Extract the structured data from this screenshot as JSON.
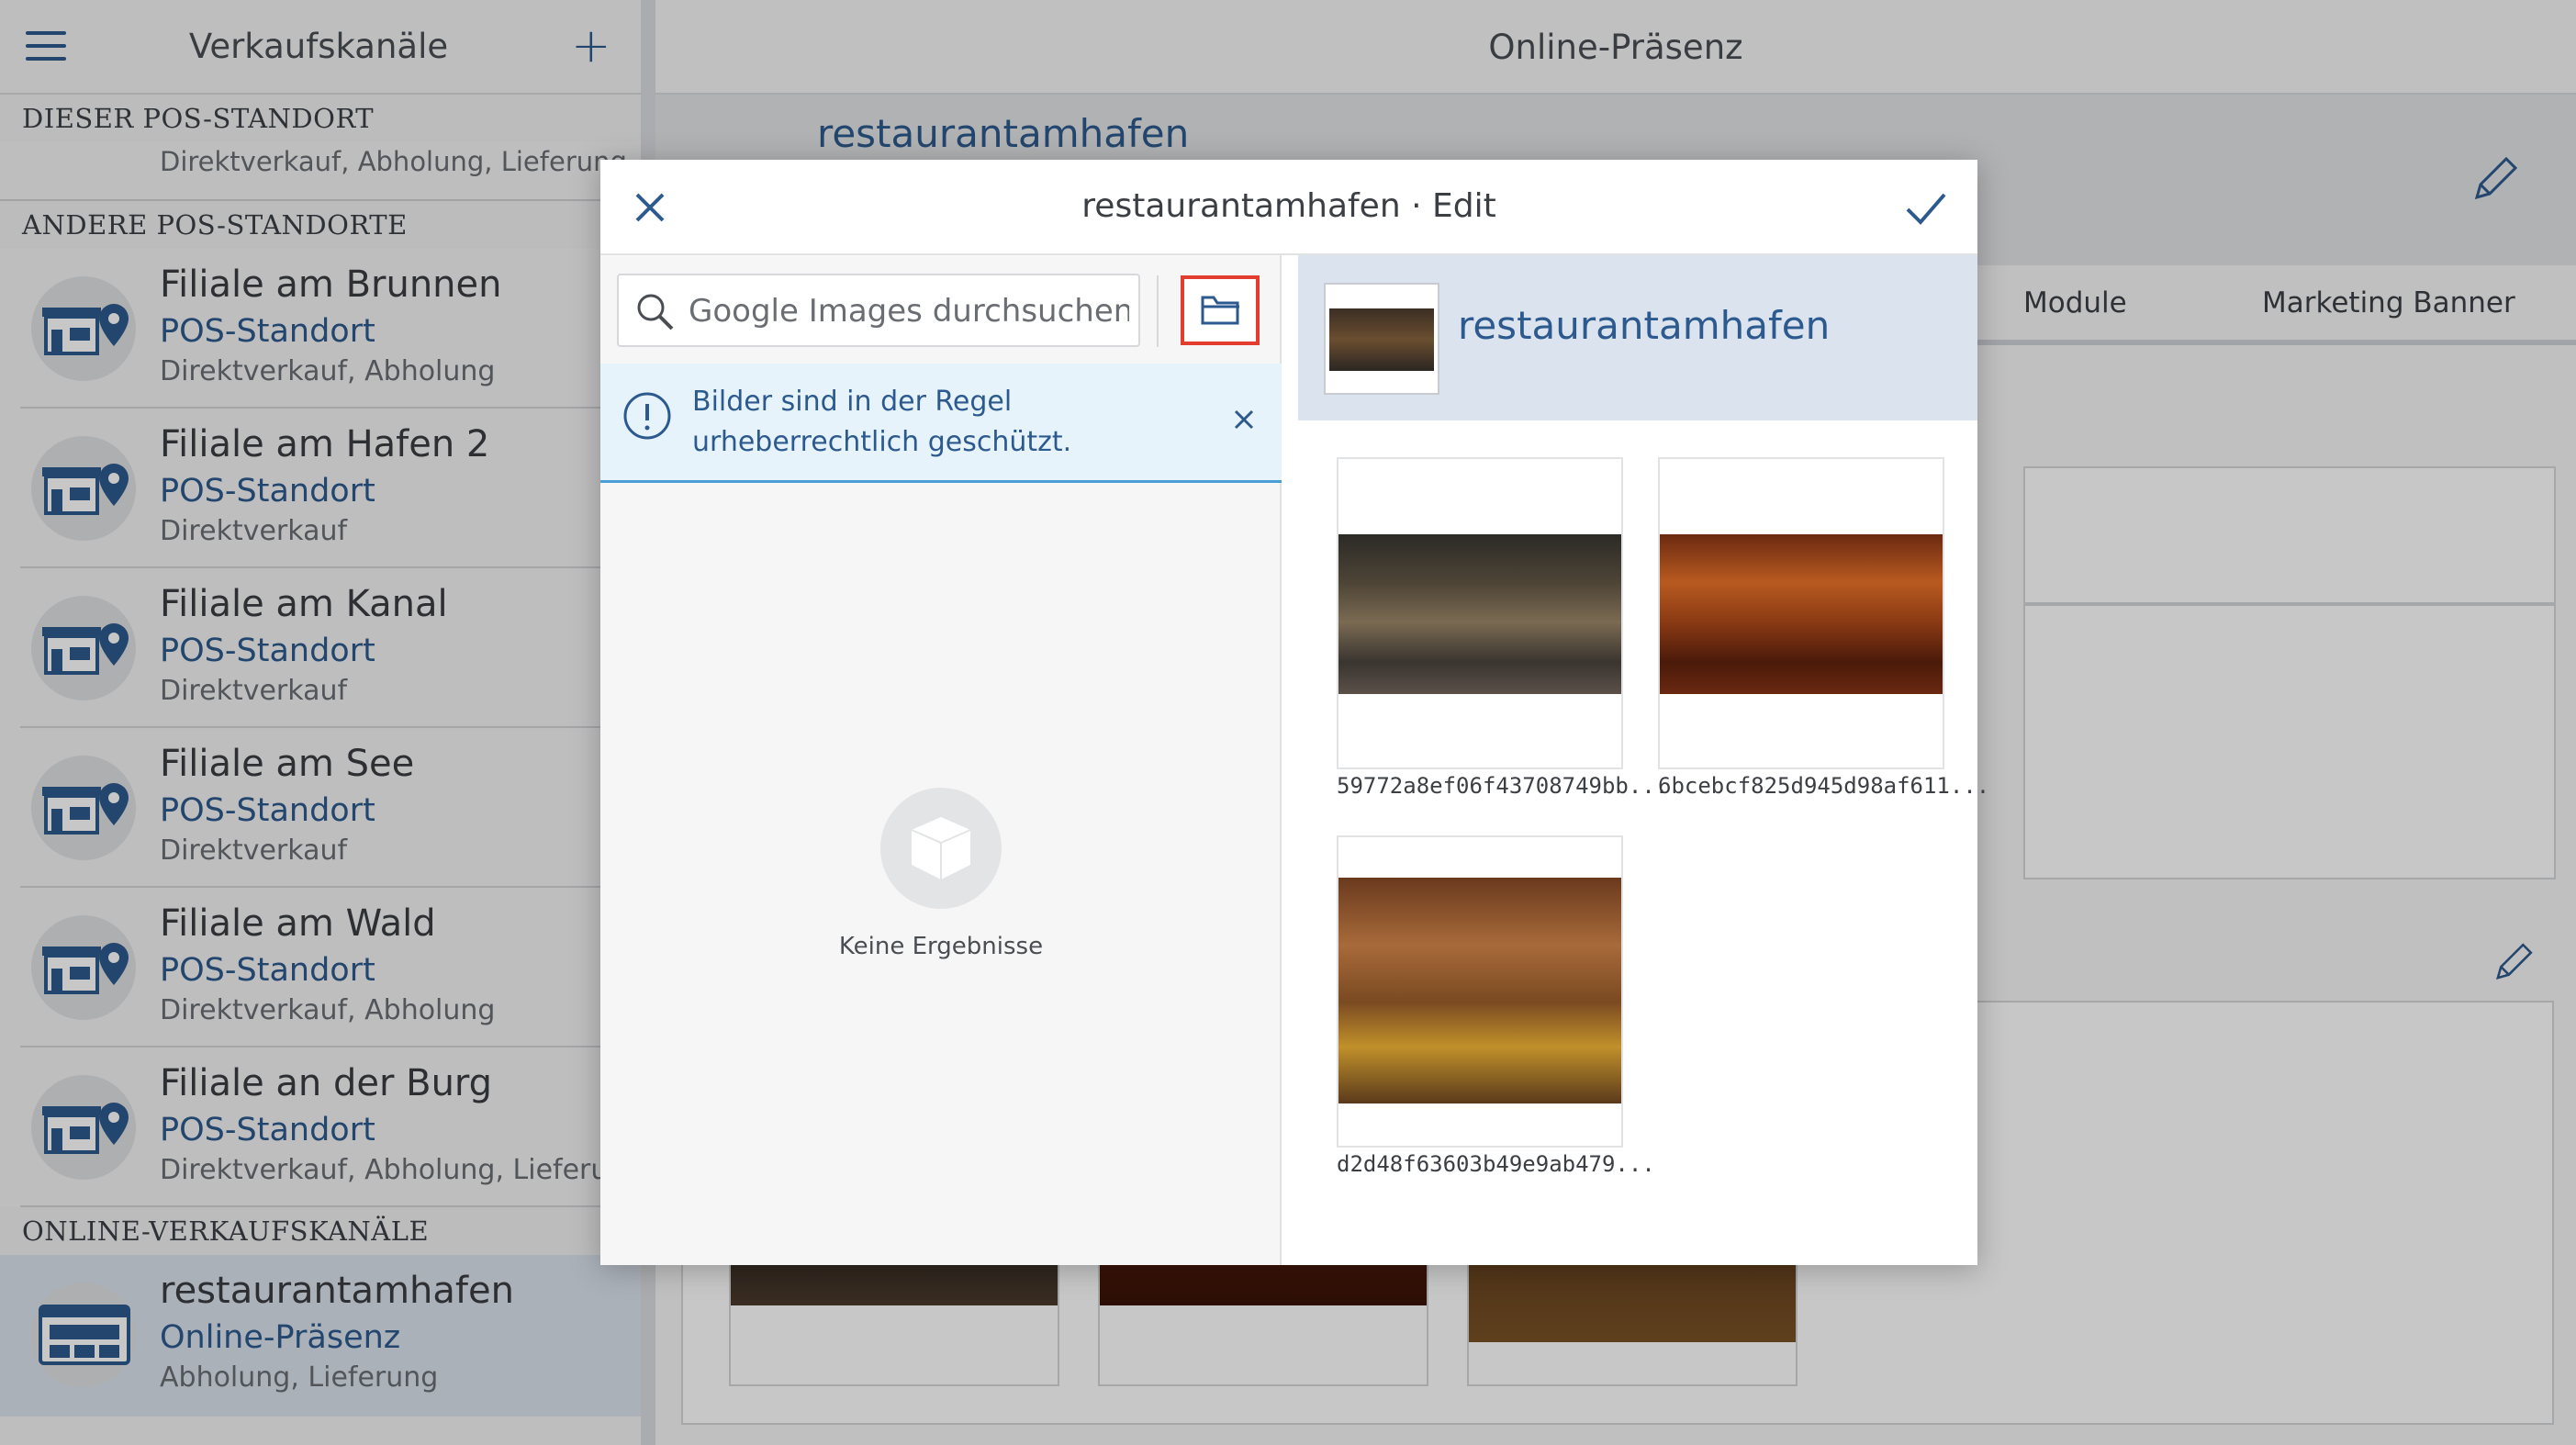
{
  "sidebar": {
    "title": "Verkaufskanäle",
    "add_label": "+",
    "section_this": "DIESER POS-STANDORT",
    "this_location_modes": "Direktverkauf, Abholung, Lieferung",
    "section_other": "ANDERE POS-STANDORTE",
    "locations": [
      {
        "name": "Filiale am Brunnen",
        "type": "POS-Standort",
        "modes": "Direktverkauf, Abholung"
      },
      {
        "name": "Filiale am Hafen 2",
        "type": "POS-Standort",
        "modes": "Direktverkauf"
      },
      {
        "name": "Filiale am Kanal",
        "type": "POS-Standort",
        "modes": "Direktverkauf"
      },
      {
        "name": "Filiale am See",
        "type": "POS-Standort",
        "modes": "Direktverkauf"
      },
      {
        "name": "Filiale am Wald",
        "type": "POS-Standort",
        "modes": "Direktverkauf, Abholung"
      },
      {
        "name": "Filiale an der Burg",
        "type": "POS-Standort",
        "modes": "Direktverkauf, Abholung, Lieferung"
      }
    ],
    "section_online": "ONLINE-VERKAUFSKANÄLE",
    "online": {
      "name": "restaurantamhafen",
      "type": "Online-Präsenz",
      "modes": "Abholung, Lieferung"
    }
  },
  "main": {
    "title": "Online-Präsenz",
    "header_name": "restaurantamhafen",
    "tabs": [
      "Module",
      "Marketing Banner"
    ]
  },
  "modal": {
    "title": "restaurantamhafen · Edit",
    "search_placeholder": "Google Images durchsuchen ...",
    "alert_text": "Bilder sind in der Regel urheberrechtlich geschützt.",
    "empty_text": "Keine Ergebnisse",
    "right_title": "restaurantamhafen",
    "images": [
      {
        "label": "59772a8ef06f43708749bb..."
      },
      {
        "label": "6bcebcf825d945d98af611..."
      },
      {
        "label": "d2d48f63603b49e9ab479..."
      }
    ]
  },
  "colors": {
    "brand": "#2d5a8e",
    "highlight": "#e33d2f",
    "alert_bg": "#e6f3fb"
  }
}
